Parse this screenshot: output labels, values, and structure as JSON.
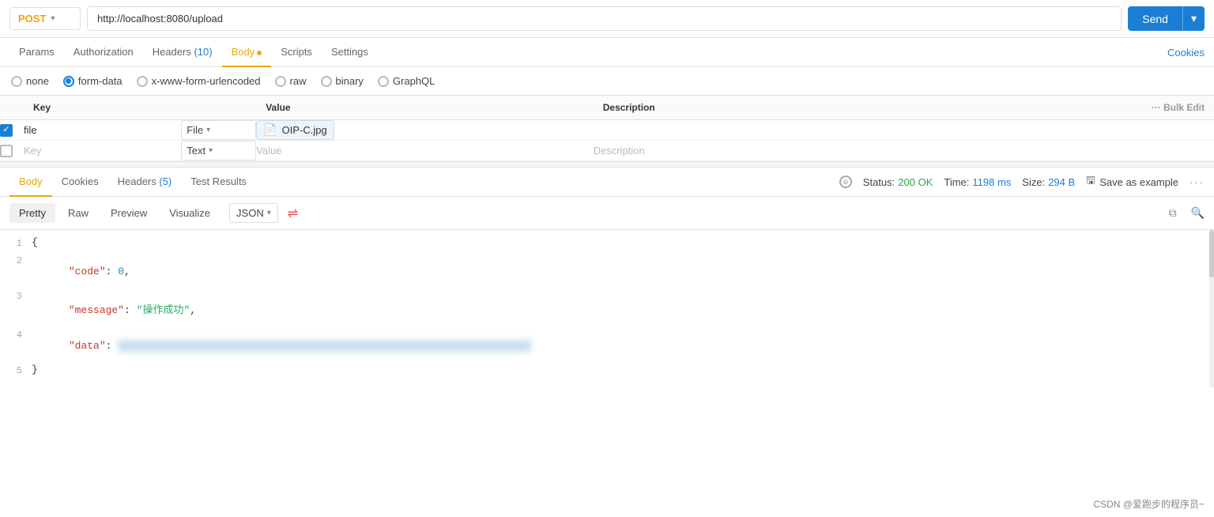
{
  "topbar": {
    "method": "POST",
    "url": "http://localhost:8080/upload",
    "send_label": "Send",
    "arrow": "▾"
  },
  "tabs": [
    {
      "label": "Params",
      "active": false,
      "badge": null,
      "dot": false
    },
    {
      "label": "Authorization",
      "active": false,
      "badge": null,
      "dot": false
    },
    {
      "label": "Headers",
      "active": false,
      "badge": "(10)",
      "dot": false
    },
    {
      "label": "Body",
      "active": true,
      "badge": null,
      "dot": true
    },
    {
      "label": "Scripts",
      "active": false,
      "badge": null,
      "dot": false
    },
    {
      "label": "Settings",
      "active": false,
      "badge": null,
      "dot": false
    }
  ],
  "cookies_link": "Cookies",
  "radio_options": [
    {
      "label": "none",
      "checked": false
    },
    {
      "label": "form-data",
      "checked": true
    },
    {
      "label": "x-www-form-urlencoded",
      "checked": false
    },
    {
      "label": "raw",
      "checked": false
    },
    {
      "label": "binary",
      "checked": false
    },
    {
      "label": "GraphQL",
      "checked": false
    }
  ],
  "table": {
    "columns": [
      "Key",
      "Value",
      "Description"
    ],
    "bulk_edit": "Bulk Edit",
    "rows": [
      {
        "checked": true,
        "key": "file",
        "type": "File",
        "value_type": "file",
        "value": "OIP-C.jpg",
        "description": ""
      },
      {
        "checked": false,
        "key": "Key",
        "type": "Text",
        "value_type": "placeholder",
        "value": "Value",
        "description": "Description"
      }
    ]
  },
  "response": {
    "tabs": [
      {
        "label": "Body",
        "active": true,
        "badge": null
      },
      {
        "label": "Cookies",
        "active": false,
        "badge": null
      },
      {
        "label": "Headers",
        "active": false,
        "badge": "(5)"
      },
      {
        "label": "Test Results",
        "active": false,
        "badge": null
      }
    ],
    "status_label": "Status:",
    "status_value": "200 OK",
    "time_label": "Time:",
    "time_value": "1198 ms",
    "size_label": "Size:",
    "size_value": "294 B",
    "save_example": "Save as example",
    "format_tabs": [
      {
        "label": "Pretty",
        "active": true
      },
      {
        "label": "Raw",
        "active": false
      },
      {
        "label": "Preview",
        "active": false
      },
      {
        "label": "Visualize",
        "active": false
      }
    ],
    "format_select": "JSON",
    "code_lines": [
      {
        "num": "1",
        "content": "{"
      },
      {
        "num": "2",
        "content": "    \"code\": 0,"
      },
      {
        "num": "3",
        "content": "    \"message\": \"操作成功\","
      },
      {
        "num": "4",
        "content": "    \"data\": ",
        "blurred": true
      },
      {
        "num": "5",
        "content": "}"
      }
    ]
  },
  "watermark": "CSDN @爱跑步的程序员~"
}
